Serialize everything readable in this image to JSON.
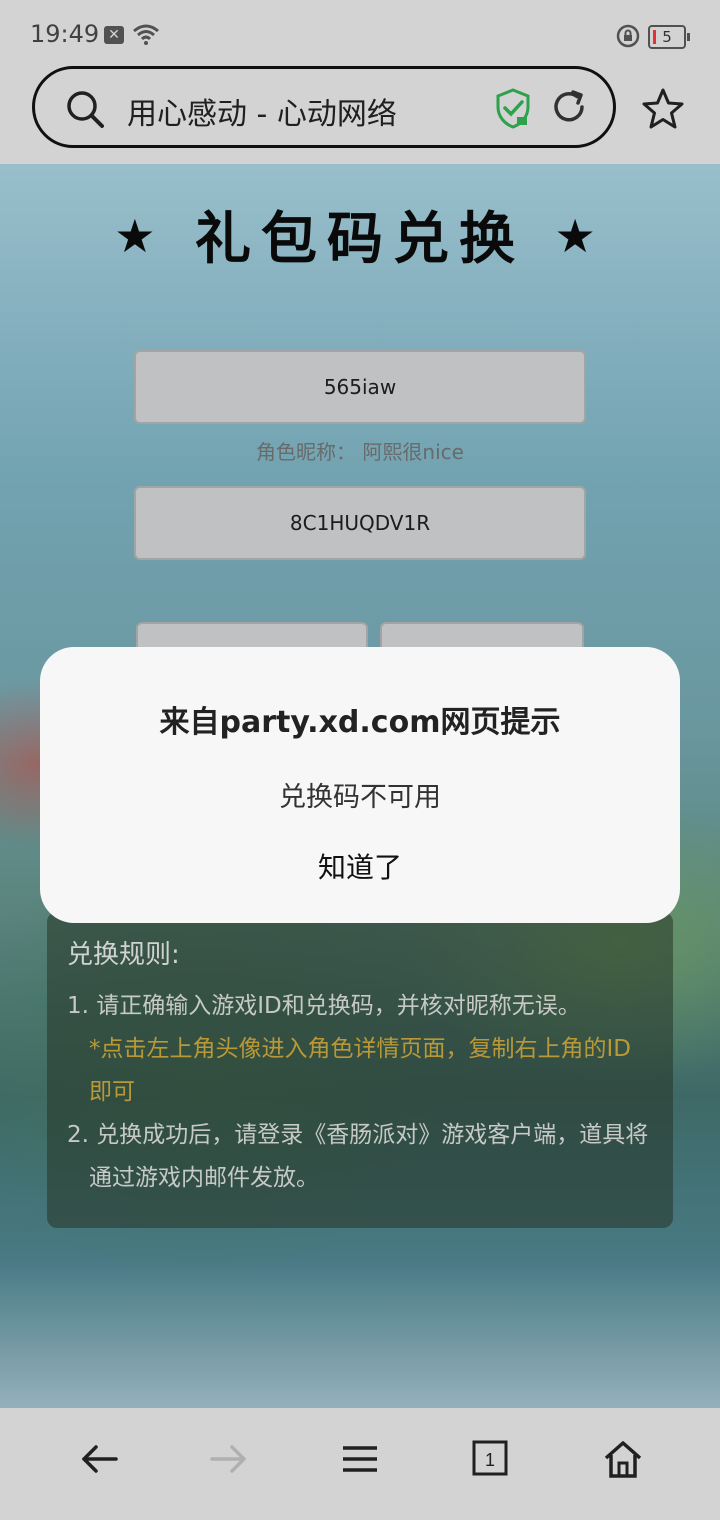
{
  "status_bar": {
    "time": "19:49",
    "battery_level": "5"
  },
  "browser": {
    "url_title": "用心感动 - 心动网络",
    "icons": [
      "search-icon",
      "shield-check-icon",
      "reload-icon",
      "star-icon"
    ]
  },
  "page": {
    "headline": "礼包码兑换",
    "game_id_value": "565iaw",
    "nickname_label": "角色昵称：",
    "nickname_value": "阿熙很nice",
    "code_value": "8C1HUQDV1R",
    "rules": {
      "title": "兑换规则:",
      "rule1": "1. 请正确输入游戏ID和兑换码，并核对昵称无误。",
      "rule1_note": "*点击左上角头像进入角色详情页面，复制右上角的ID即可",
      "rule2": "2. 兑换成功后，请登录《香肠派对》游戏客户端，道具将通过游戏内邮件发放。"
    }
  },
  "dialog": {
    "title": "来自party.xd.com网页提示",
    "message": "兑换码不可用",
    "confirm_label": "知道了"
  },
  "navbar": {
    "tab_count": "1",
    "icons": [
      "back-icon",
      "forward-icon",
      "menu-icon",
      "tabs-icon",
      "home-icon"
    ]
  },
  "colors": {
    "accent_green": "#2fa84f",
    "rule_note": "#c1a03a",
    "dialog_bg": "#f7f7f7"
  }
}
